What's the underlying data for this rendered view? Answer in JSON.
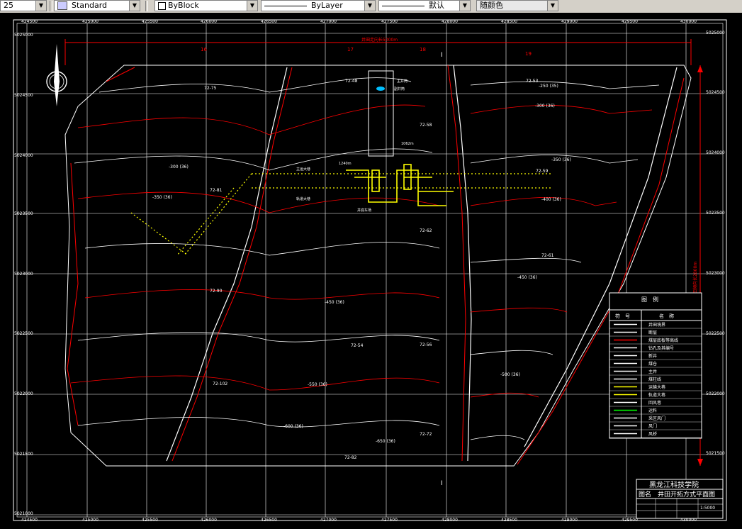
{
  "toolbar": {
    "first_combo": "25",
    "text_style": "Standard",
    "color": "ByBlock",
    "linetype": "ByLayer",
    "lineweight": "默认",
    "plot_style": "随颜色"
  },
  "colors": {
    "background": "#000000",
    "grid": "#ffffff",
    "red": "#ff0000",
    "yellow": "#ffff00",
    "green": "#00ff00"
  },
  "top_coords": [
    "424500",
    "425000",
    "425500",
    "426000",
    "426500",
    "427000",
    "427500",
    "428000",
    "428500",
    "429000",
    "429500",
    "430000"
  ],
  "bottom_coords": [
    "424500",
    "425000",
    "425500",
    "426000",
    "426500",
    "427000",
    "427500",
    "428000",
    "428500",
    "429000",
    "429500",
    "430000"
  ],
  "left_coords": [
    "5025000",
    "5024500",
    "5024000",
    "5023500",
    "5023000",
    "5022500",
    "5022000",
    "5021500",
    "5021000"
  ],
  "right_coords": [
    "5025000",
    "5024500",
    "5024000",
    "5023500",
    "5023000",
    "5022500",
    "5022000",
    "5021500"
  ],
  "line_labels": [
    "16",
    "17",
    "18",
    "19"
  ],
  "section_label": "I",
  "top_dimension": "井田走向长5000m",
  "right_dimension": "井田倾向长2800m",
  "boreholes": [
    "72-75",
    "72-81",
    "72-90",
    "72-102",
    "72-48",
    "72-58",
    "72-62",
    "72-54",
    "72-56",
    "72-72",
    "72-82",
    "72-53",
    "72-59",
    "72-61"
  ],
  "contours": [
    "-250 (35)",
    "-300 (36)",
    "-350 (36)",
    "-400 (36)",
    "-450 (36)",
    "-500 (36)",
    "-550 (36)",
    "-600 (36)",
    "-650 (36)"
  ],
  "annotations": [
    "主井筒",
    "副井筒",
    "1062m",
    "1240m",
    "主运大巷",
    "轨道大巷",
    "井底车场"
  ],
  "legend": {
    "title": "图　例",
    "col_symbol": "符　号",
    "col_name": "名　称",
    "items": [
      "井田境界",
      "断层",
      "煤层底板等高线",
      "钻孔及其编号",
      "新井",
      "煤仓",
      "主井",
      "煤柱线",
      "运输大巷",
      "轨道大巷",
      "回风巷",
      "运料",
      "采区风门",
      "风门",
      "风桥"
    ]
  },
  "title_block": {
    "school": "黑龙江科技学院",
    "drawing_title": "图名　井田开拓方式平面图",
    "scale": "1:5000"
  }
}
